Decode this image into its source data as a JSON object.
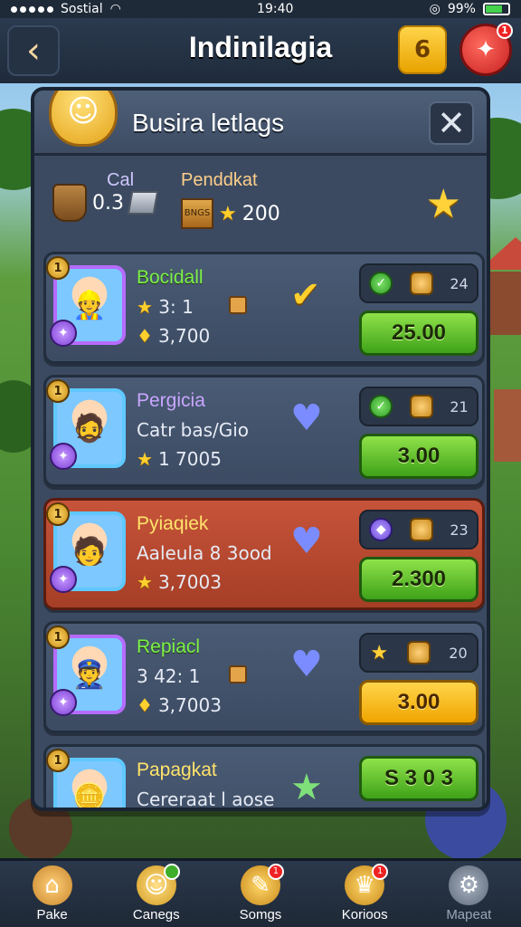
{
  "status_bar": {
    "carrier": "Sostial",
    "time": "19:40",
    "battery": "99%"
  },
  "top_bar": {
    "title": "Indinilagia",
    "coin_count": "6",
    "alert_badge": "1"
  },
  "panel": {
    "title": "Busira letlags",
    "summary": {
      "left_label": "Cal",
      "left_value": "0.3",
      "right_label": "Penddkat",
      "crate_text": "BNGS",
      "star_value": "200"
    }
  },
  "cards": [
    {
      "level": "1",
      "name": "Bocidall",
      "subtitle": "3: 1",
      "stat": "3,700",
      "chip_value": "24",
      "price": "25.00",
      "price_style": "green",
      "chip_left": "check",
      "mid_icon": "checkmark"
    },
    {
      "level": "1",
      "name": "Pergicia",
      "subtitle": "Catr bas/Gio",
      "stat": "1 7005",
      "chip_value": "21",
      "price": "3.00",
      "price_style": "green",
      "chip_left": "check",
      "mid_icon": "gem-chest"
    },
    {
      "level": "1",
      "name": "Pyiaqiek",
      "subtitle": "Aaleula 8 3ood",
      "stat": "3,7003",
      "chip_value": "23",
      "price": "2.300",
      "price_style": "green",
      "chip_left": "shield",
      "mid_icon": "gem-chest",
      "featured": true
    },
    {
      "level": "1",
      "name": "Repiacl",
      "subtitle": "3 42: 1",
      "stat": "3,7003",
      "chip_value": "20",
      "price": "3.00",
      "price_style": "orange",
      "chip_left": "star",
      "mid_icon": "gem-chest"
    },
    {
      "level": "1",
      "name": "Papagkat",
      "subtitle": "Cereraat l aose",
      "stat": "",
      "chip_value": "",
      "price": "S 3 0 3",
      "price_style": "green",
      "chip_left": "",
      "mid_icon": "star"
    }
  ],
  "bottom_nav": [
    {
      "label": "Pake",
      "icon": "house-icon"
    },
    {
      "label": "Canegs",
      "icon": "chat-icon",
      "badge": "green"
    },
    {
      "label": "Somgs",
      "icon": "rocket-icon",
      "badge": "1"
    },
    {
      "label": "Korioos",
      "icon": "trophy-icon",
      "badge": "1"
    },
    {
      "label": "Mapeat",
      "icon": "gear-icon"
    }
  ]
}
